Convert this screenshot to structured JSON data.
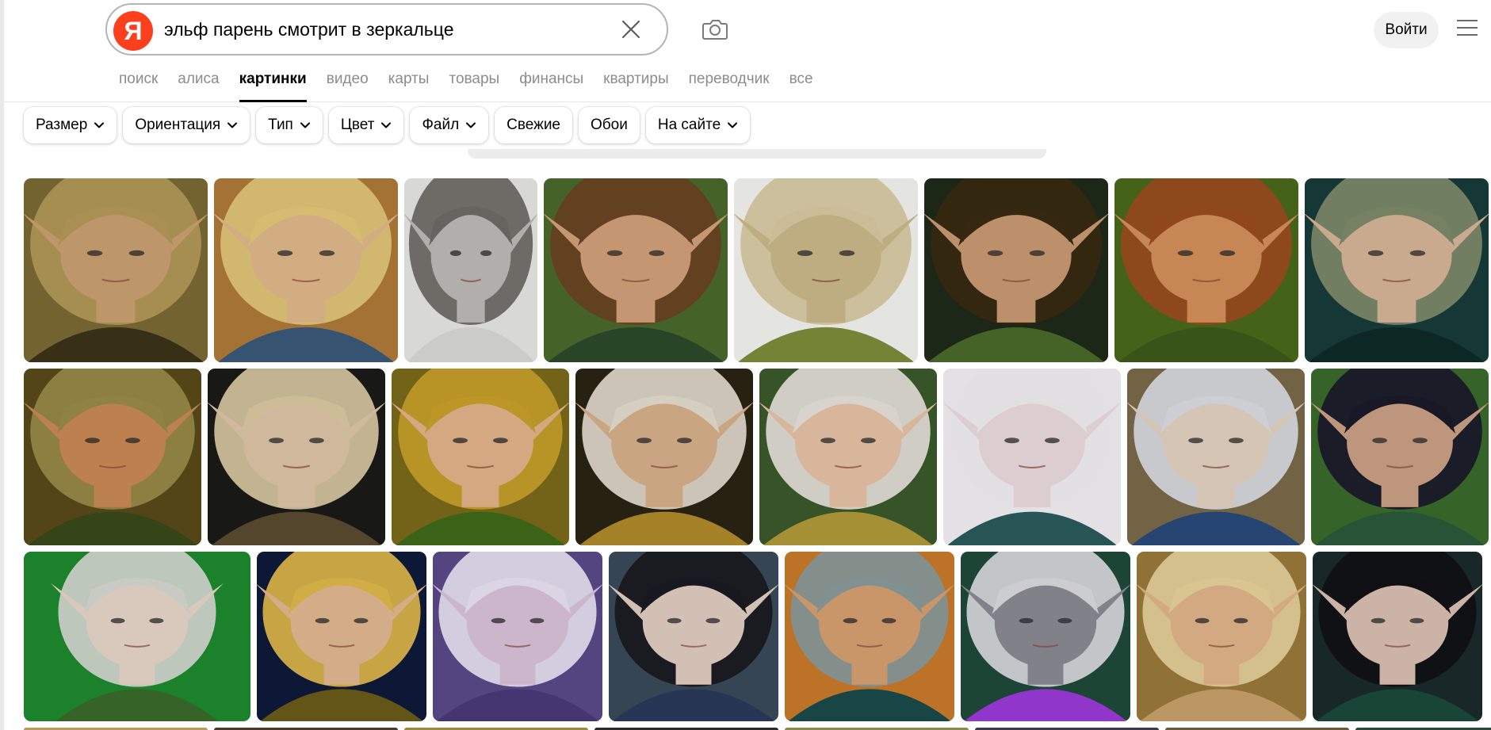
{
  "search": {
    "query": "эльф парень смотрит в зеркальце",
    "logo_letter": "Я"
  },
  "header": {
    "login_label": "Войти"
  },
  "nav": {
    "tabs": [
      {
        "label": "поиск",
        "active": false
      },
      {
        "label": "алиса",
        "active": false
      },
      {
        "label": "картинки",
        "active": true
      },
      {
        "label": "видео",
        "active": false
      },
      {
        "label": "карты",
        "active": false
      },
      {
        "label": "товары",
        "active": false
      },
      {
        "label": "финансы",
        "active": false
      },
      {
        "label": "квартиры",
        "active": false
      },
      {
        "label": "переводчик",
        "active": false
      },
      {
        "label": "все",
        "active": false
      }
    ]
  },
  "filters": [
    {
      "label": "Размер",
      "dropdown": true
    },
    {
      "label": "Ориентация",
      "dropdown": true
    },
    {
      "label": "Тип",
      "dropdown": true
    },
    {
      "label": "Цвет",
      "dropdown": true
    },
    {
      "label": "Файл",
      "dropdown": true
    },
    {
      "label": "Свежие",
      "dropdown": false
    },
    {
      "label": "Обои",
      "dropdown": false
    },
    {
      "label": "На сайте",
      "dropdown": true
    }
  ],
  "results": {
    "rows": [
      [
        {
          "bg": "#7a6a34",
          "skin": "#c9a070",
          "hair": "#b49a58",
          "accent": "#3b3418"
        },
        {
          "bg": "#b07a3a",
          "skin": "#e0b88a",
          "hair": "#e3c879",
          "accent": "#3a5a7a"
        },
        {
          "bg": "#e6e6e4",
          "skin": "#bdbab6",
          "hair": "#6e6b66",
          "accent": "#d8d8d6"
        },
        {
          "bg": "#4a6a2c",
          "skin": "#d1a07a",
          "hair": "#6a4424",
          "accent": "#2c4a2a"
        },
        {
          "bg": "#f3f3f0",
          "skin": "#c9b88a",
          "hair": "#d7c8a0",
          "accent": "#7c8c3a"
        },
        {
          "bg": "#1f2a1a",
          "skin": "#c89a72",
          "hair": "#3a2a12",
          "accent": "#4a6a2a"
        },
        {
          "bg": "#4a6a1a",
          "skin": "#d3905a",
          "hair": "#9a4c1e",
          "accent": "#3c5a1a"
        },
        {
          "bg": "#173c3a",
          "skin": "#d6b598",
          "hair": "#7e8a6a",
          "accent": "#0e2a28"
        }
      ],
      [
        {
          "bg": "#5a4a1a",
          "skin": "#c98a55",
          "hair": "#9a8a4a",
          "accent": "#3a4a1a"
        },
        {
          "bg": "#1a1a18",
          "skin": "#dcc4a6",
          "hair": "#d9c9a0",
          "accent": "#5a4a30"
        },
        {
          "bg": "#7a6a1a",
          "skin": "#e2b48a",
          "hair": "#c8a02a",
          "accent": "#3f6a1a"
        },
        {
          "bg": "#2a2414",
          "skin": "#d7b08a",
          "hair": "#e3dccc",
          "accent": "#b08a2a"
        },
        {
          "bg": "#3a5a2a",
          "skin": "#e6c2a6",
          "hair": "#e6e2da",
          "accent": "#b09a3a"
        },
        {
          "bg": "#f2f0f2",
          "skin": "#eadadf",
          "hair": "#f0eef0",
          "accent": "#2a5a5a"
        },
        {
          "bg": "#7a6a4a",
          "skin": "#e3d2c0",
          "hair": "#dadce2",
          "accent": "#2a4a7a"
        },
        {
          "bg": "#3a6a2a",
          "skin": "#c9a084",
          "hair": "#1a1a2a",
          "accent": "#2a5a3a"
        }
      ],
      [
        {
          "bg": "#1e8a2e",
          "skin": "#e6d6c8",
          "hair": "#d4d8d0",
          "accent": "#3a6a2a"
        },
        {
          "bg": "#0e1a3a",
          "skin": "#e0b890",
          "hair": "#e0b84a",
          "accent": "#6a5a1a"
        },
        {
          "bg": "#5a4a8a",
          "skin": "#d8c2d8",
          "hair": "#e8e2f2",
          "accent": "#4a3a7a"
        },
        {
          "bg": "#3a4a5a",
          "skin": "#e0ccc0",
          "hair": "#1a1a22",
          "accent": "#2a3a5a"
        },
        {
          "bg": "#c87a2a",
          "skin": "#d6a070",
          "hair": "#8a9a9a",
          "accent": "#1a4a4a"
        },
        {
          "bg": "#1e4a3a",
          "skin": "#8a8a92",
          "hair": "#dadade",
          "accent": "#9a3ad8"
        },
        {
          "bg": "#9a7a3a",
          "skin": "#e0b48a",
          "hair": "#e6d29a",
          "accent": "#c8a06a"
        },
        {
          "bg": "#1a2a2a",
          "skin": "#d8c0b0",
          "hair": "#121216",
          "accent": "#1a4a3a"
        }
      ]
    ]
  },
  "colors": {
    "logo_red": "#fc3f1d",
    "nav_inactive": "#8c8c8c",
    "border": "#b5b5b5"
  },
  "icons": {
    "clear": "close-icon",
    "camera": "camera-icon",
    "menu": "hamburger-menu-icon",
    "chevron": "chevron-down-icon"
  }
}
